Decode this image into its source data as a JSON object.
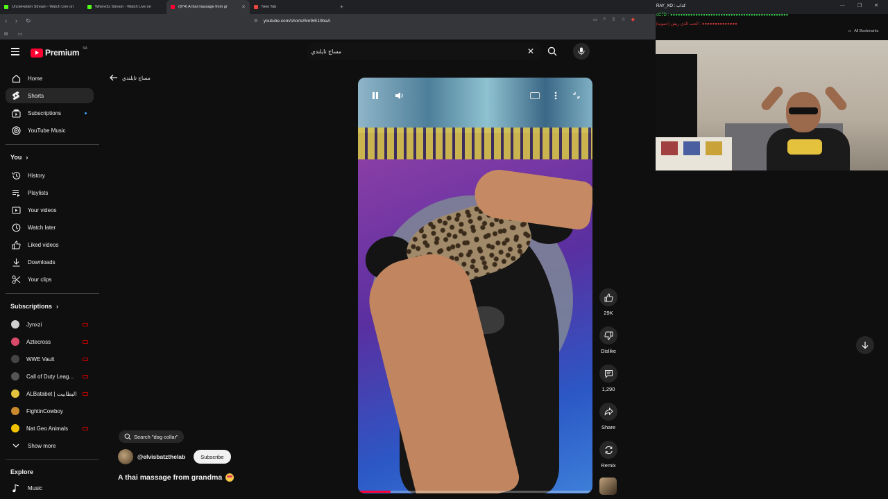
{
  "browser": {
    "tabs": [
      {
        "label": "UncleHatten Stream - Watch Live on",
        "color": "#53fc18"
      },
      {
        "label": "Where3z Stream - Watch Live on",
        "color": "#53fc18"
      },
      {
        "label": "(874) A thai massage from gr",
        "color": "#ff0033"
      },
      {
        "label": "New Tab",
        "color": "#e8453c"
      }
    ],
    "url": "youtube.com/shorts/5m9rE19baA",
    "all_bookmarks": "All Bookmarks"
  },
  "chat": {
    "lines": [
      "RAY_XO : كذاب",
      "cC7D : ●●●●●●●●●●●●●●●●●●●●●●●●●●●●●●●●●●●●●●●●●●●●●●●",
      "الحب الذي ريش (حمويه) : ●●●●●●●●●●●●●●"
    ]
  },
  "youtube": {
    "logo_text": "Premium",
    "country_code": "SA",
    "search_query": "مساج تايلندي",
    "back_label": "مساج تايلندي",
    "sidebar": {
      "main": [
        {
          "label": "Home",
          "icon": "home-icon"
        },
        {
          "label": "Shorts",
          "icon": "shorts-icon"
        },
        {
          "label": "Subscriptions",
          "icon": "subscriptions-icon"
        },
        {
          "label": "YouTube Music",
          "icon": "youtube-music-icon"
        }
      ],
      "you_title": "You",
      "you": [
        {
          "label": "History",
          "icon": "history-icon"
        },
        {
          "label": "Playlists",
          "icon": "playlists-icon"
        },
        {
          "label": "Your videos",
          "icon": "your-videos-icon"
        },
        {
          "label": "Watch later",
          "icon": "watch-later-icon"
        },
        {
          "label": "Liked videos",
          "icon": "liked-videos-icon"
        },
        {
          "label": "Downloads",
          "icon": "downloads-icon"
        },
        {
          "label": "Your clips",
          "icon": "clips-icon"
        }
      ],
      "subs_title": "Subscriptions",
      "subs": [
        {
          "label": "Jynxzi",
          "color": "#cfcfcf"
        },
        {
          "label": "Aztecross",
          "color": "#d94a6a"
        },
        {
          "label": "WWE Vault",
          "color": "#222222"
        },
        {
          "label": "Call of Duty Leag...",
          "color": "#444444"
        },
        {
          "label": "ALBatabet | البطابيت",
          "color": "#e5c23d"
        },
        {
          "label": "FightinCowboy",
          "color": "#c98a2e"
        },
        {
          "label": "Nat Geo Animals",
          "color": "#f2c200"
        }
      ],
      "show_more": "Show more",
      "explore_title": "Explore",
      "explore": [
        {
          "label": "Music",
          "icon": "music-icon"
        }
      ]
    },
    "actions": {
      "like_count": "29K",
      "dislike_label": "Dislike",
      "comment_count": "1,290",
      "share_label": "Share",
      "remix_label": "Remix"
    },
    "video": {
      "search_chip": "Search \"dog collar\"",
      "channel": "@elvisbatzthelab",
      "subscribe_label": "Subscribe",
      "title": "A thai massage from grandma",
      "progress": 0.14
    }
  },
  "colors": {
    "brand": "#ff0033",
    "background": "#0f0f0f",
    "surface": "#272727"
  }
}
